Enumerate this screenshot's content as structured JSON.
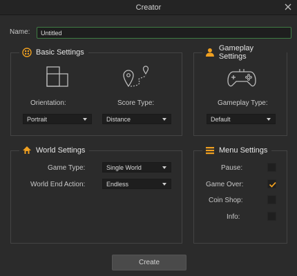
{
  "window": {
    "title": "Creator"
  },
  "name": {
    "label": "Name:",
    "value": "Untitled"
  },
  "basic_settings": {
    "title": "Basic Settings",
    "orientation": {
      "label": "Orientation:",
      "value": "Portrait"
    },
    "score_type": {
      "label": "Score Type:",
      "value": "Distance"
    }
  },
  "gameplay_settings": {
    "title": "Gameplay Settings",
    "gameplay_type": {
      "label": "Gameplay Type:",
      "value": "Default"
    }
  },
  "world_settings": {
    "title": "World Settings",
    "game_type": {
      "label": "Game Type:",
      "value": "Single World"
    },
    "world_end_action": {
      "label": "World End Action:",
      "value": "Endless"
    }
  },
  "menu_settings": {
    "title": "Menu Settings",
    "items": [
      {
        "label": "Pause:",
        "checked": false
      },
      {
        "label": "Game Over:",
        "checked": true
      },
      {
        "label": "Coin Shop:",
        "checked": false
      },
      {
        "label": "Info:",
        "checked": false
      }
    ]
  },
  "create_button": {
    "label": "Create"
  },
  "colors": {
    "accent": "#f0a020",
    "background": "#2b2b2b",
    "input_border": "#3f7d44"
  }
}
